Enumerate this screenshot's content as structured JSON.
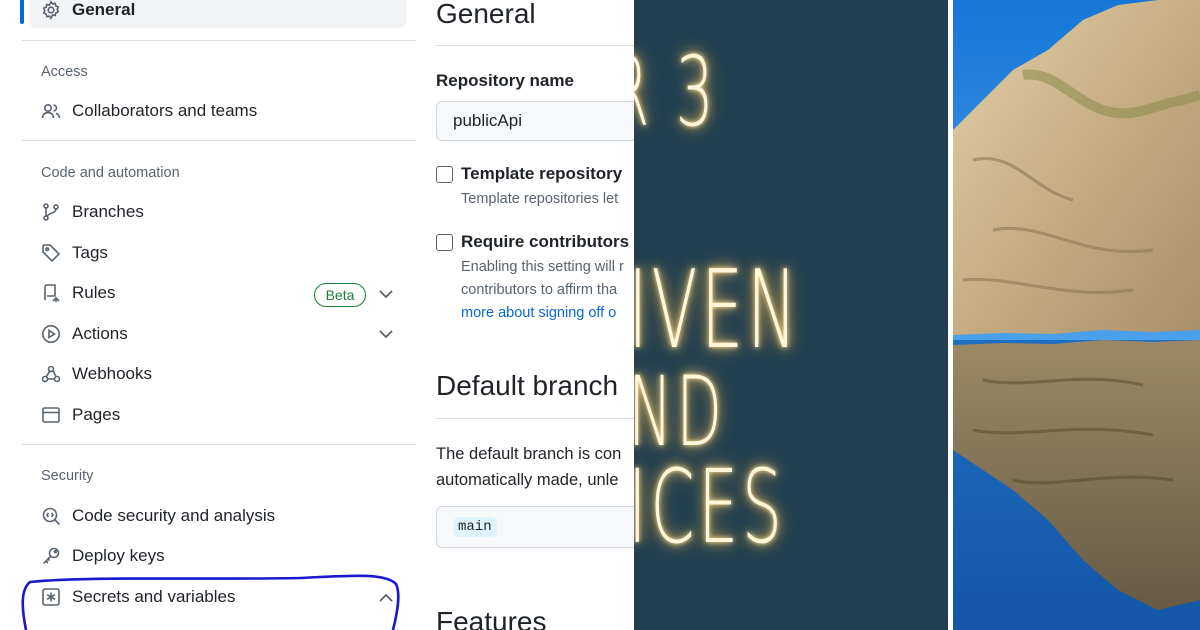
{
  "sidebar": {
    "active_item": {
      "label": "General",
      "icon": "gear-icon"
    },
    "sections": {
      "access": "Access",
      "code_automation": "Code and automation",
      "security": "Security"
    },
    "items": {
      "collaborators": {
        "label": "Collaborators and teams",
        "icon": "people-icon"
      },
      "branches": {
        "label": "Branches",
        "icon": "git-branch-icon"
      },
      "tags": {
        "label": "Tags",
        "icon": "tag-icon"
      },
      "rules": {
        "label": "Rules",
        "icon": "repo-push-icon",
        "badge": "Beta"
      },
      "actions": {
        "label": "Actions",
        "icon": "play-icon"
      },
      "webhooks": {
        "label": "Webhooks",
        "icon": "webhook-icon"
      },
      "pages": {
        "label": "Pages",
        "icon": "browser-icon"
      },
      "code_security": {
        "label": "Code security and analysis",
        "icon": "codescan-icon"
      },
      "deploy_keys": {
        "label": "Deploy keys",
        "icon": "key-icon"
      },
      "secrets": {
        "label": "Secrets and variables",
        "icon": "asterisk-icon"
      }
    },
    "accent_color": "#0969da",
    "annotation_color": "#1a1acc"
  },
  "settings": {
    "title": "General",
    "repo_name_label": "Repository name",
    "repo_name_value": "publicApi",
    "template_label": "Template repository",
    "template_desc": "Template repositories let",
    "require_label": "Require contributors",
    "require_desc_1": "Enabling this setting will r",
    "require_desc_2": "contributors to affirm tha",
    "require_desc_link": "more about signing off o",
    "default_branch_title": "Default branch",
    "default_branch_desc_1": "The default branch is con",
    "default_branch_desc_2": "automatically made, unle",
    "default_branch_value": "main",
    "features_title": "Features"
  },
  "poster": {
    "line1": "R 3",
    "line2": "IVEN",
    "line3": "ND",
    "line4": "ICES",
    "bg_color": "#203f52",
    "glow_color": "#f3c260"
  }
}
